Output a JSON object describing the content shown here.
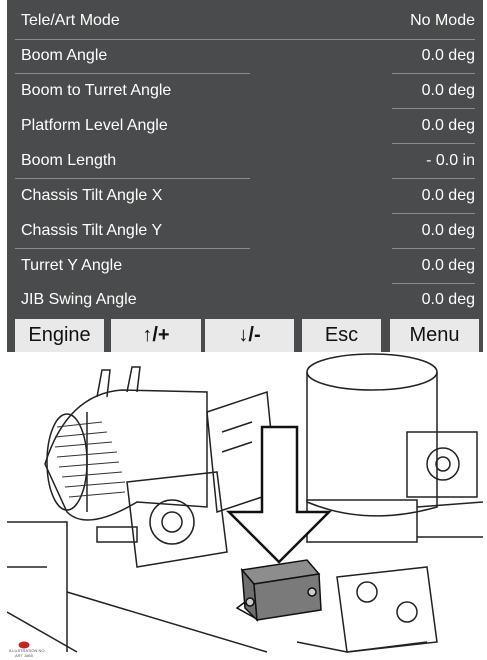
{
  "header": {
    "label": "Tele/Art Mode",
    "value": "No Mode"
  },
  "readouts": [
    {
      "label": "Boom Angle",
      "value": "0.0 deg"
    },
    {
      "label": "Boom to Turret Angle",
      "value": "0.0 deg"
    },
    {
      "label": "Platform Level Angle",
      "value": "0.0 deg"
    },
    {
      "label": "Boom Length",
      "value": "- 0.0 in"
    },
    {
      "label": "Chassis Tilt Angle X",
      "value": "0.0 deg"
    },
    {
      "label": "Chassis Tilt Angle Y",
      "value": "0.0 deg"
    },
    {
      "label": "Turret Y Angle",
      "value": "0.0 deg"
    },
    {
      "label": "JIB Swing Angle",
      "value": "0.0 deg"
    }
  ],
  "buttons": {
    "engine": "Engine",
    "up": "↑/+",
    "down": "↓/-",
    "esc": "Esc",
    "menu": "Menu"
  },
  "logo": {
    "line1": "ILLUSTRATION NO.",
    "line2": "ART 1665"
  },
  "colors": {
    "panel": "#4a4b4c",
    "button": "#e9e9e9",
    "text": "#ffffff"
  }
}
